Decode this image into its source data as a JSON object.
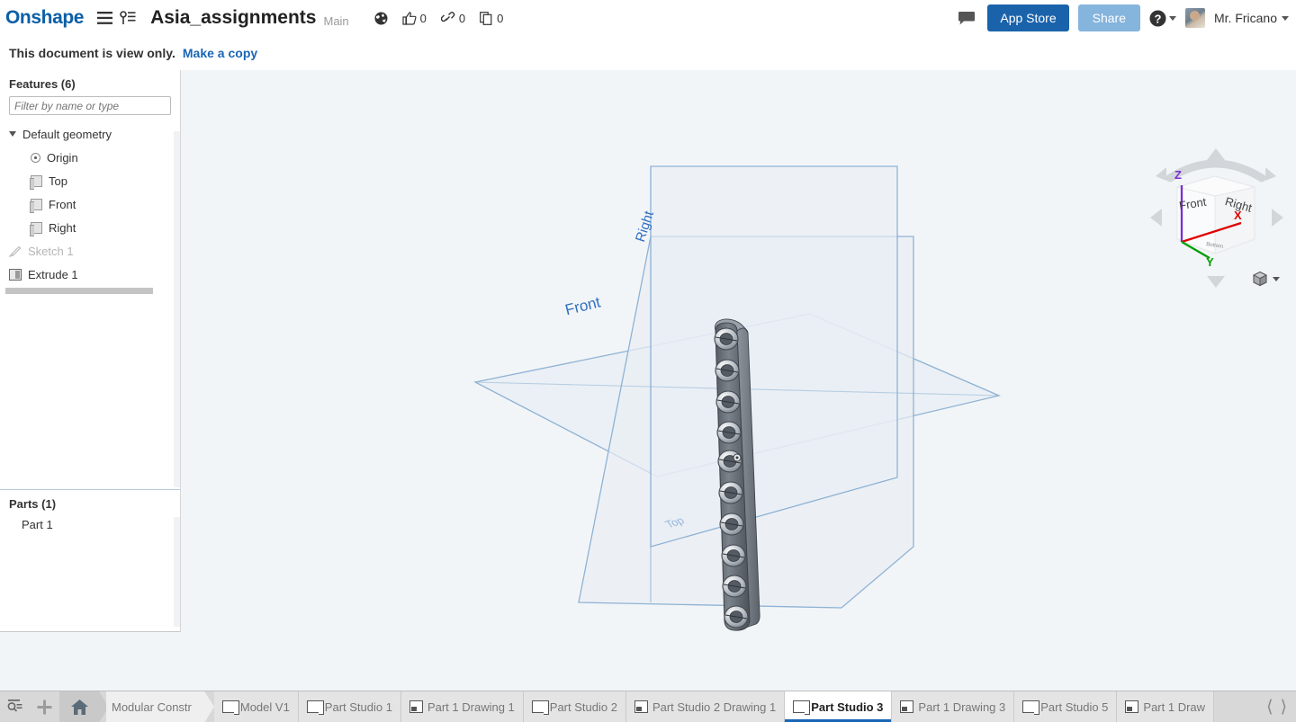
{
  "header": {
    "logo": "Onshape",
    "menu_icon": "hamburger-menu-icon",
    "version_icon": "version-history-icon",
    "doc_title": "Asia_assignments",
    "branch": "Main",
    "public_icon": "globe-icon",
    "stats": [
      {
        "icon": "thumbs-up-icon",
        "count": "0"
      },
      {
        "icon": "link-icon",
        "count": "0"
      },
      {
        "icon": "copy-icon",
        "count": "0"
      }
    ],
    "comment_icon": "comment-icon",
    "app_store_label": "App Store",
    "share_label": "Share",
    "help_icon": "help-icon",
    "avatar_name": "avatar",
    "user_name": "Mr. Fricano"
  },
  "banner": {
    "text": "This document is view only.",
    "link": "Make a copy"
  },
  "sidebar": {
    "features_title": "Features (6)",
    "filter_placeholder": "Filter by name or type",
    "tree": [
      {
        "label": "Default geometry",
        "icon": "chevron-down-icon",
        "level": 1,
        "dim": false
      },
      {
        "label": "Origin",
        "icon": "origin-icon",
        "level": 2,
        "dim": false
      },
      {
        "label": "Top",
        "icon": "plane-icon",
        "level": 2,
        "dim": false
      },
      {
        "label": "Front",
        "icon": "plane-icon",
        "level": 2,
        "dim": false
      },
      {
        "label": "Right",
        "icon": "plane-icon",
        "level": 2,
        "dim": false
      },
      {
        "label": "Sketch 1",
        "icon": "sketch-icon",
        "level": 1,
        "dim": true
      },
      {
        "label": "Extrude 1",
        "icon": "extrude-icon",
        "level": 1,
        "dim": false
      }
    ],
    "parts_title": "Parts (1)",
    "parts": [
      {
        "label": "Part 1"
      }
    ]
  },
  "viewport": {
    "background": "#f2f5f8",
    "plane_labels": [
      {
        "name": "Right",
        "text": "Right"
      },
      {
        "name": "Front",
        "text": "Front"
      },
      {
        "name": "Top",
        "text": "Top"
      }
    ],
    "plane_fill": "#e8edf3",
    "plane_stroke": "#8fb2d4",
    "part_color": "#6a717a"
  },
  "viewcube": {
    "face_front": "Front",
    "face_right": "Right",
    "axis_x": "X",
    "axis_y": "Y",
    "axis_z": "Z",
    "axis_x_color": "#e00000",
    "axis_y_color": "#00a000",
    "axis_z_color": "#7b2fd0",
    "view_style_icon": "cube-icon",
    "view_style_caret": "chevron-down-icon"
  },
  "tabbar": {
    "search_icon": "search-tabs-icon",
    "add_icon": "add-tab-icon",
    "home_icon": "home-icon",
    "breadcrumb": "Modular Constr",
    "tabs": [
      {
        "label": "Model V1",
        "icon": "part-studio-icon",
        "active": false
      },
      {
        "label": "Part Studio 1",
        "icon": "part-studio-icon",
        "active": false
      },
      {
        "label": "Part 1 Drawing 1",
        "icon": "drawing-icon",
        "active": false
      },
      {
        "label": "Part Studio 2",
        "icon": "part-studio-icon",
        "active": false
      },
      {
        "label": "Part Studio 2 Drawing 1",
        "icon": "drawing-icon",
        "active": false
      },
      {
        "label": "Part Studio 3",
        "icon": "part-studio-icon",
        "active": true
      },
      {
        "label": "Part 1 Drawing 3",
        "icon": "drawing-icon",
        "active": false
      },
      {
        "label": "Part Studio 5",
        "icon": "part-studio-icon",
        "active": false
      },
      {
        "label": "Part 1 Draw",
        "icon": "drawing-icon",
        "active": false
      }
    ],
    "prev_icon": "chevron-left-icon",
    "next_icon": "chevron-right-icon"
  }
}
